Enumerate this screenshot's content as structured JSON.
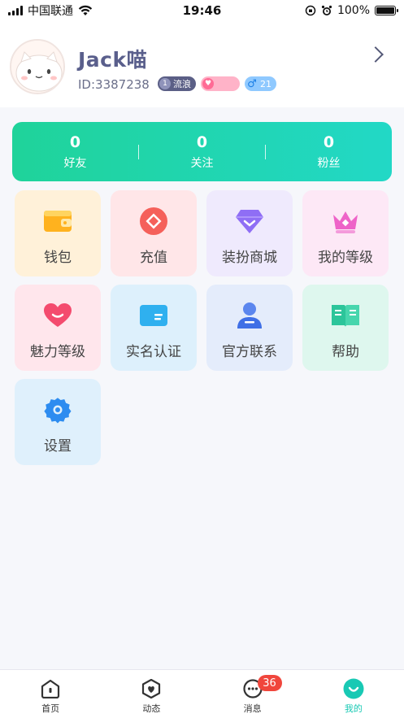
{
  "status_bar": {
    "carrier": "中国联通",
    "time": "19:46",
    "battery": "100%"
  },
  "profile": {
    "username": "Jack喵",
    "user_id": "ID:3387238",
    "level_num": "1",
    "level_title": "流浪",
    "gender_age": "21"
  },
  "stats": [
    {
      "value": "0",
      "label": "好友"
    },
    {
      "value": "0",
      "label": "关注"
    },
    {
      "value": "0",
      "label": "粉丝"
    }
  ],
  "menu": [
    {
      "label": "钱包",
      "icon": "wallet-icon",
      "bg": "#fff1d9"
    },
    {
      "label": "充值",
      "icon": "recharge-icon",
      "bg": "#ffe6e8"
    },
    {
      "label": "装扮商城",
      "icon": "diamond-icon",
      "bg": "#efeafd"
    },
    {
      "label": "我的等级",
      "icon": "crown-icon",
      "bg": "#fde8f6"
    },
    {
      "label": "魅力等级",
      "icon": "heart-icon",
      "bg": "#ffe6ec"
    },
    {
      "label": "实名认证",
      "icon": "id-card-icon",
      "bg": "#ddf0fc"
    },
    {
      "label": "官方联系",
      "icon": "service-person-icon",
      "bg": "#e4ecfb"
    },
    {
      "label": "帮助",
      "icon": "help-book-icon",
      "bg": "#def7ee"
    },
    {
      "label": "设置",
      "icon": "settings-gear-icon",
      "bg": "#dff0fc"
    }
  ],
  "tabs": [
    {
      "label": "首页",
      "icon": "home-icon"
    },
    {
      "label": "动态",
      "icon": "moments-icon"
    },
    {
      "label": "消息",
      "icon": "message-icon",
      "badge": "36"
    },
    {
      "label": "我的",
      "icon": "profile-smile-icon"
    }
  ],
  "colors": {
    "accent": "#1fd39a",
    "accent_end": "#22d8c6",
    "username": "#5a5f8c",
    "badge_red": "#f0463c"
  }
}
